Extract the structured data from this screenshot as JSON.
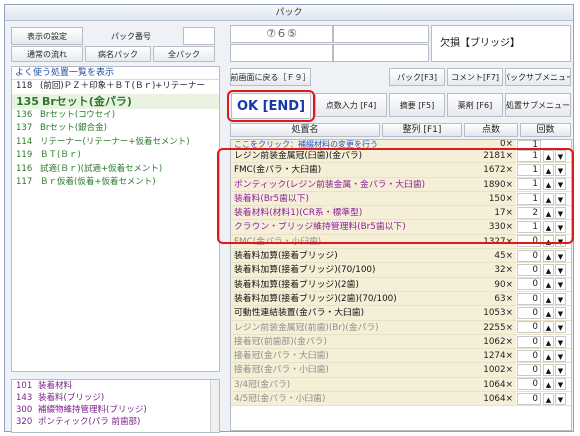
{
  "window": {
    "title": "パック"
  },
  "top_left": {
    "settings_button": "表示の設定",
    "pack_number_label": "パック番号",
    "pack_number_value": "",
    "normal_flow_button": "通常の流れ",
    "disease_pack_button": "病名パック",
    "all_pack_button": "全パック"
  },
  "top_right": {
    "tooth_field": "⑦６⑤",
    "status_text": "欠損【ブリッジ】"
  },
  "frequent_list": {
    "header": "よく使う処置一覧を表示",
    "items": [
      {
        "code": "118",
        "label": "(前回)ＰＺ＋印象＋ＢＴ(Ｂｒ)+リテーナー",
        "style": "plain"
      },
      {
        "code": "135",
        "label": "Brセット(金パラ)",
        "style": "big"
      },
      {
        "code": "136",
        "label": "Brセット(コウセイ)",
        "style": "normal"
      },
      {
        "code": "137",
        "label": "Brセット(銀合金)",
        "style": "normal"
      },
      {
        "code": "114",
        "label": "リテーナー(リテーナー+仮着セメント)",
        "style": "normal"
      },
      {
        "code": "119",
        "label": "ＢＴ(Ｂｒ)",
        "style": "normal"
      },
      {
        "code": "116",
        "label": "試適(Ｂｒ)(試適+仮着セメント)",
        "style": "normal"
      },
      {
        "code": "117",
        "label": "Ｂｒ仮着(仮着+仮着セメント)",
        "style": "normal"
      }
    ]
  },
  "bottom_list": {
    "items": [
      {
        "code": "101",
        "label": "装着材料"
      },
      {
        "code": "143",
        "label": "装着料(ブリッジ)"
      },
      {
        "code": "300",
        "label": "補綴物維持管理料(ブリッジ)"
      },
      {
        "code": "320",
        "label": "ポンティック(パラ 前歯部)"
      }
    ]
  },
  "toolbar": {
    "back_button": "前画面に戻る［Ｆ９］",
    "pack_button": "パック[F3]",
    "comment_button": "コメント[F7]",
    "pack_sub_button": "パックサブメニュー",
    "ok_button": "OK [END]",
    "points_input_button": "点数入力 [F4]",
    "summary_button": "摘要 [F5]",
    "drug_button": "薬剤 [F6]",
    "procedure_sub_button": "処置サブメニュー"
  },
  "table": {
    "headers": {
      "name": "処置名",
      "sort": "整列 [F1]",
      "points": "点数",
      "count": "回数"
    },
    "partial_row": {
      "name": "ここをクリック：補綴材料の変更を行う",
      "points": "0×",
      "count": "1"
    },
    "rows": [
      {
        "name": "レジン前装金属冠(臼歯)(金パラ)",
        "points": "2181×",
        "count": "1",
        "color": "black"
      },
      {
        "name": "FMC(金パラ・大臼歯)",
        "points": "1672×",
        "count": "1",
        "color": "black"
      },
      {
        "name": "ポンティック(レジン前装金属・金パラ・大臼歯)",
        "points": "1890×",
        "count": "1",
        "color": "purple"
      },
      {
        "name": "装着料(Br5歯以下)",
        "points": "150×",
        "count": "1",
        "color": "purple"
      },
      {
        "name": "装着材料(材料1)(CR系・標準型)",
        "points": "17×",
        "count": "2",
        "color": "purple"
      },
      {
        "name": "クラウン・ブリッジ維持管理料(Br5歯以下)",
        "points": "330×",
        "count": "1",
        "color": "purple"
      },
      {
        "name": "FMC(金パラ・小臼歯)",
        "points": "1327×",
        "count": "0",
        "color": "gray"
      },
      {
        "name": "装着料加算(接着ブリッジ)",
        "points": "45×",
        "count": "0",
        "color": "black"
      },
      {
        "name": "装着料加算(接着ブリッジ)(70/100)",
        "points": "32×",
        "count": "0",
        "color": "black"
      },
      {
        "name": "装着料加算(接着ブリッジ)(2歯)",
        "points": "90×",
        "count": "0",
        "color": "black"
      },
      {
        "name": "装着料加算(接着ブリッジ)(2歯)(70/100)",
        "points": "63×",
        "count": "0",
        "color": "black"
      },
      {
        "name": "可動性連結装置(金パラ・大臼歯)",
        "points": "1053×",
        "count": "0",
        "color": "black"
      },
      {
        "name": "レジン前装金属冠(前歯)(Br)(金パラ)",
        "points": "2255×",
        "count": "0",
        "color": "gray"
      },
      {
        "name": "接着冠(前歯部)(金パラ)",
        "points": "1062×",
        "count": "0",
        "color": "gray"
      },
      {
        "name": "接着冠(金パラ・大臼歯)",
        "points": "1274×",
        "count": "0",
        "color": "gray"
      },
      {
        "name": "接着冠(金パラ・小臼歯)",
        "points": "1002×",
        "count": "0",
        "color": "gray"
      },
      {
        "name": "3/4冠(金パラ)",
        "points": "1064×",
        "count": "0",
        "color": "gray"
      },
      {
        "name": "4/5冠(金パラ・小臼歯)",
        "points": "1064×",
        "count": "0",
        "color": "gray"
      }
    ]
  },
  "arrows": {
    "up": "▲",
    "down": "▼"
  }
}
